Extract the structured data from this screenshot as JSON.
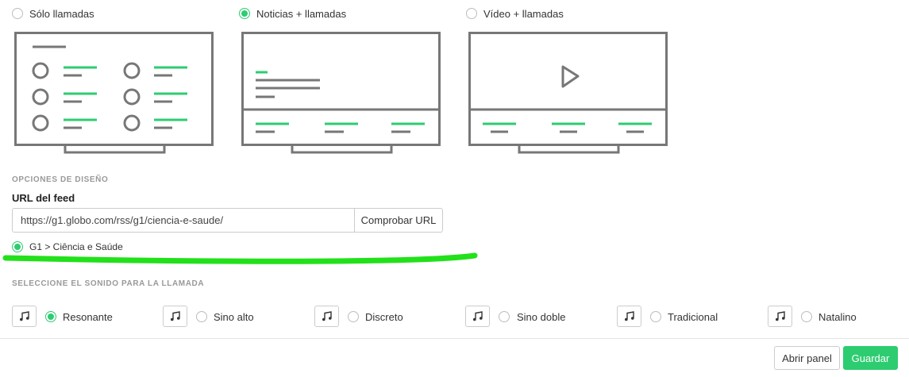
{
  "layouts": [
    {
      "label": "Sólo llamadas",
      "selected": false
    },
    {
      "label": "Noticias + llamadas",
      "selected": true
    },
    {
      "label": "Vídeo + llamadas",
      "selected": false
    }
  ],
  "design": {
    "section_title": "OPCIONES DE DISEÑO",
    "url_label": "URL del feed",
    "url_value": "https://g1.globo.com/rss/g1/ciencia-e-saude/",
    "check_button": "Comprobar URL",
    "feed_result": "G1 > Ciência e Saúde"
  },
  "sound": {
    "section_title": "SELECCIONE EL SONIDO PARA LA LLAMADA",
    "options": [
      {
        "label": "Resonante",
        "selected": true
      },
      {
        "label": "Sino alto",
        "selected": false
      },
      {
        "label": "Discreto",
        "selected": false
      },
      {
        "label": "Sino doble",
        "selected": false
      },
      {
        "label": "Tradicional",
        "selected": false
      },
      {
        "label": "Natalino",
        "selected": false
      }
    ]
  },
  "footer": {
    "open_panel": "Abrir panel",
    "save": "Guardar"
  },
  "colors": {
    "accent": "#2ecc71",
    "highlight_stroke": "#22e11a",
    "outline": "#777777"
  },
  "icons": {
    "sound_button": "music-note-icon",
    "video_play": "play-icon"
  }
}
